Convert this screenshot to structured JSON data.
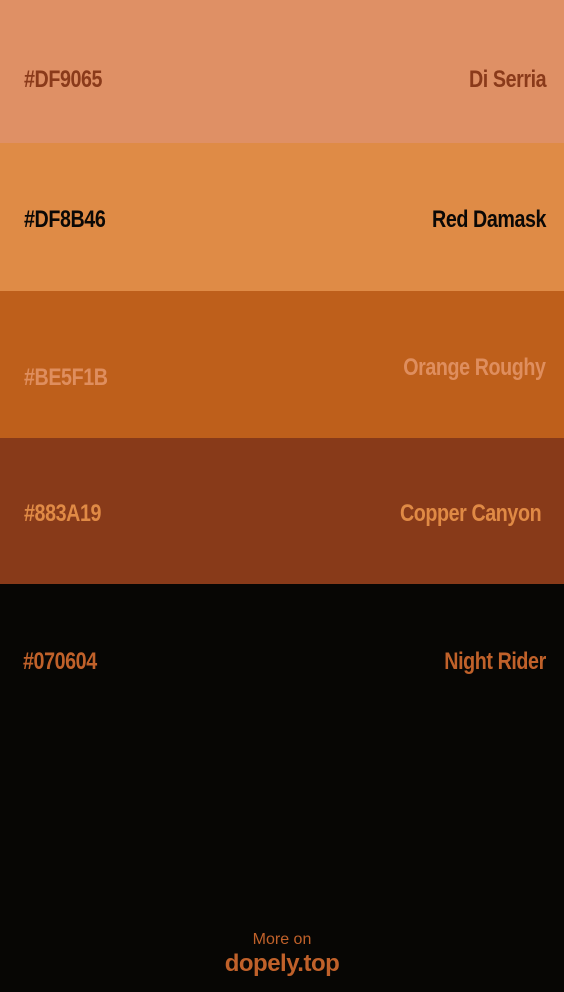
{
  "swatches": [
    {
      "hex": "#DF9065",
      "name": "Di Serria",
      "bg": "#DF9065",
      "hex_color": "#8A3A1A",
      "name_color": "#8A3A1A"
    },
    {
      "hex": "#DF8B46",
      "name": "Red Damask",
      "bg": "#DF8B46",
      "hex_color": "#0A0806",
      "name_color": "#0A0806"
    },
    {
      "hex": "#BE5F1B",
      "name": "Orange Roughy",
      "bg": "#BE5F1B",
      "hex_color": "#DF8E5E",
      "name_color": "#DF8E5E"
    },
    {
      "hex": "#883A19",
      "name": "Copper Canyon",
      "bg": "#883A19",
      "hex_color": "#E08A45",
      "name_color": "#E08A45"
    },
    {
      "hex": "#070604",
      "name": "Night Rider",
      "bg": "#070604",
      "hex_color": "#C0612A",
      "name_color": "#C0612A"
    }
  ],
  "footer": {
    "more": "More on",
    "site": "dopely.top",
    "color": "#C0612A"
  }
}
